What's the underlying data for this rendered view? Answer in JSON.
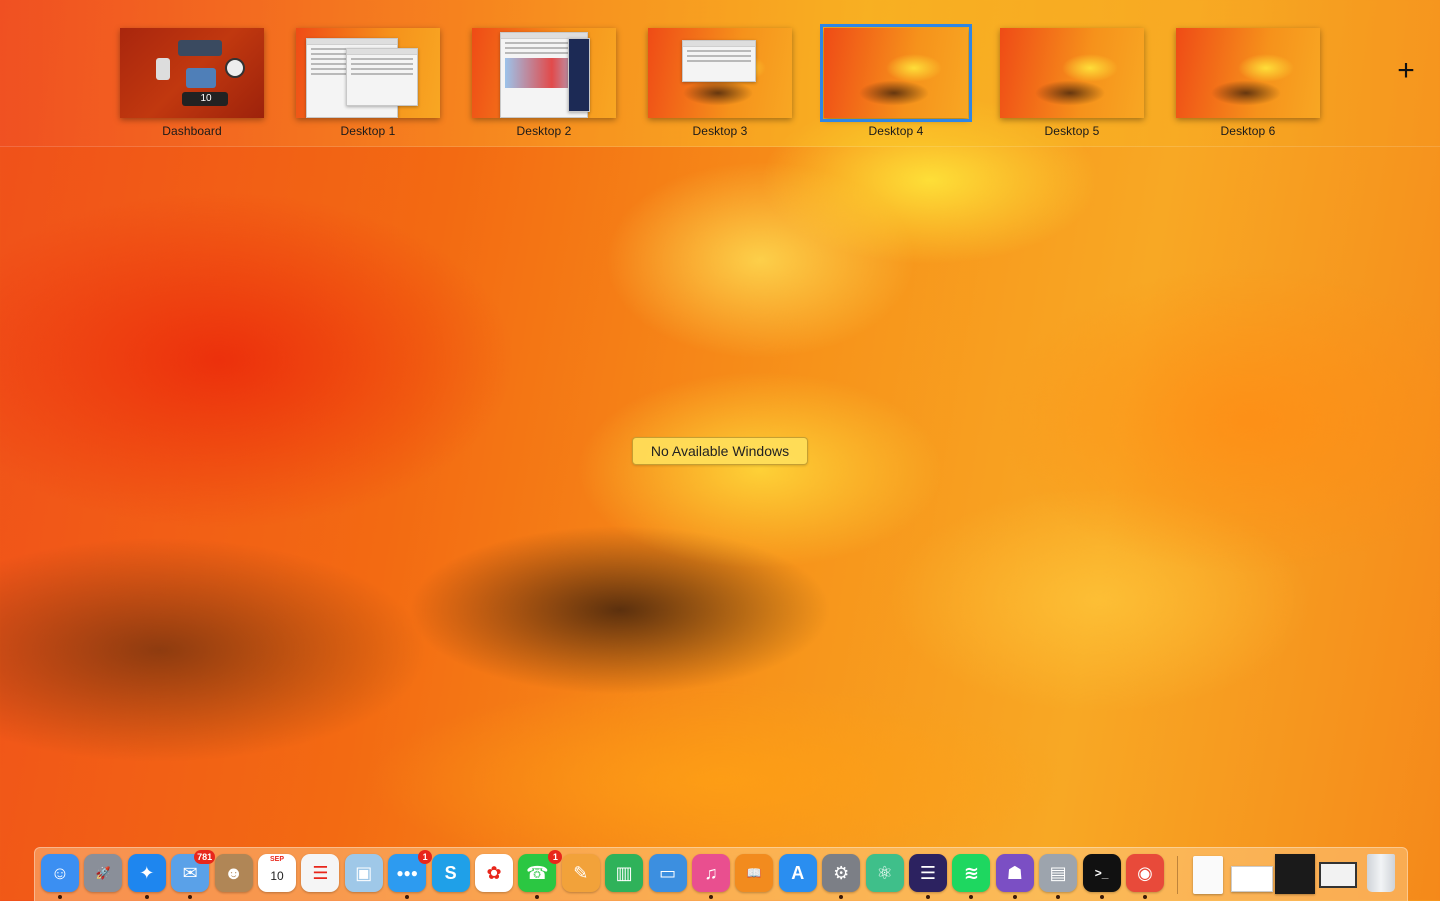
{
  "spaces_bar": {
    "spaces": [
      {
        "label": "Dashboard",
        "selected": false
      },
      {
        "label": "Desktop 1",
        "selected": false
      },
      {
        "label": "Desktop 2",
        "selected": false
      },
      {
        "label": "Desktop 3",
        "selected": false
      },
      {
        "label": "Desktop 4",
        "selected": true
      },
      {
        "label": "Desktop 5",
        "selected": false
      },
      {
        "label": "Desktop 6",
        "selected": false
      }
    ],
    "add_label": "+",
    "dashboard_widget_text": "10",
    "selection_color": "#2f86e6"
  },
  "center_message": "No Available Windows",
  "dock": {
    "apps": [
      {
        "name": "Finder",
        "icon": "finder-icon",
        "glyph": "☺",
        "color": "#3b8ff2",
        "running": true
      },
      {
        "name": "Launchpad",
        "icon": "launchpad-icon",
        "glyph": "🚀",
        "color": "#8a8f99",
        "running": false
      },
      {
        "name": "Safari",
        "icon": "safari-icon",
        "glyph": "✦",
        "color": "#1e86ef",
        "running": true
      },
      {
        "name": "Mail",
        "icon": "mail-icon",
        "glyph": "✉",
        "color": "#5aa1e8",
        "running": true,
        "badge": "781"
      },
      {
        "name": "Contacts",
        "icon": "contacts-icon",
        "glyph": "☻",
        "color": "#b08656",
        "running": false
      },
      {
        "name": "Calendar",
        "icon": "calendar-icon",
        "glyph": "10",
        "color": "#ffffff",
        "running": false,
        "month": "SEP"
      },
      {
        "name": "Reminders",
        "icon": "reminders-icon",
        "glyph": "☰",
        "color": "#f5f5f5",
        "running": false
      },
      {
        "name": "Preview",
        "icon": "preview-icon",
        "glyph": "▣",
        "color": "#9fc8e8",
        "running": false
      },
      {
        "name": "Messages",
        "icon": "messages-icon",
        "glyph": "●●●",
        "color": "#2d9bf0",
        "running": true,
        "badge": "1"
      },
      {
        "name": "Skype",
        "icon": "skype-icon",
        "glyph": "S",
        "color": "#1fa0e8",
        "running": false
      },
      {
        "name": "Photos",
        "icon": "photos-icon",
        "glyph": "✿",
        "color": "#ffffff",
        "running": false
      },
      {
        "name": "FaceTime",
        "icon": "facetime-icon",
        "glyph": "☎",
        "color": "#2bc742",
        "running": true,
        "badge": "1"
      },
      {
        "name": "Pages",
        "icon": "pages-icon",
        "glyph": "✎",
        "color": "#f2a23a",
        "running": false
      },
      {
        "name": "Numbers",
        "icon": "numbers-icon",
        "glyph": "▥",
        "color": "#2fb25a",
        "running": false
      },
      {
        "name": "Keynote",
        "icon": "keynote-icon",
        "glyph": "▭",
        "color": "#3c8fe0",
        "running": false
      },
      {
        "name": "iTunes",
        "icon": "itunes-icon",
        "glyph": "♫",
        "color": "#e94f8f",
        "running": true
      },
      {
        "name": "iBooks",
        "icon": "ibooks-icon",
        "glyph": "📖",
        "color": "#f28b1e",
        "running": false
      },
      {
        "name": "App Store",
        "icon": "app-store-icon",
        "glyph": "A",
        "color": "#2a8ef0",
        "running": false
      },
      {
        "name": "System Preferences",
        "icon": "system-preferences-icon",
        "glyph": "⚙",
        "color": "#7c7f86",
        "running": true
      },
      {
        "name": "Atom",
        "icon": "atom-icon",
        "glyph": "⚛",
        "color": "#3fbf8a",
        "running": false
      },
      {
        "name": "Eclipse",
        "icon": "eclipse-icon",
        "glyph": "☰",
        "color": "#2c2260",
        "running": true
      },
      {
        "name": "Spotify",
        "icon": "spotify-icon",
        "glyph": "≋",
        "color": "#1ed760",
        "running": true
      },
      {
        "name": "GitHub Desktop",
        "icon": "github-icon",
        "glyph": "☗",
        "color": "#7b4fc4",
        "running": true
      },
      {
        "name": "Archive Utility",
        "icon": "archive-icon",
        "glyph": "▤",
        "color": "#9da4ad",
        "running": true
      },
      {
        "name": "Terminal",
        "icon": "terminal-icon",
        "glyph": ">_",
        "color": "#111111",
        "running": true
      },
      {
        "name": "Chrome",
        "icon": "chrome-icon",
        "glyph": "◉",
        "color": "#e84a3a",
        "running": true
      }
    ],
    "documents": [
      {
        "icon": "document-icon"
      },
      {
        "icon": "document-stack-icon"
      },
      {
        "icon": "downloads-stack-icon"
      },
      {
        "icon": "window-stack-icon"
      },
      {
        "icon": "trash-icon"
      }
    ]
  }
}
